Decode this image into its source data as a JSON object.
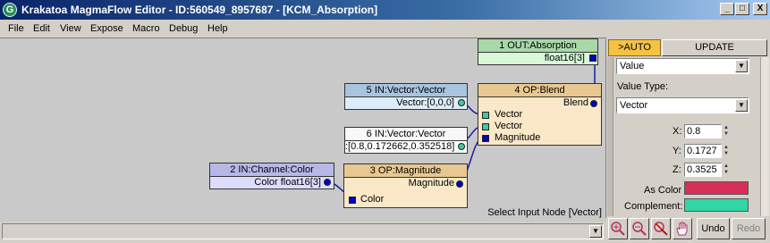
{
  "window": {
    "title": "Krakatoa MagmaFlow Editor - ID:560549_8957687 - [KCM_Absorption]",
    "icon_glyph": "G",
    "minimize_glyph": "_",
    "maximize_glyph": "□",
    "close_glyph": "X"
  },
  "menu": [
    "File",
    "Edit",
    "View",
    "Expose",
    "Macro",
    "Debug",
    "Help"
  ],
  "nodes": {
    "out_absorption": {
      "title": "1 OUT:Absorption",
      "port": "float16[3]",
      "header_color": "#a8d8a8",
      "body_color": "#d8f8d8"
    },
    "in_vector": {
      "title": "5 IN:Vector:Vector",
      "port": "Vector:[0,0,0]",
      "header_color": "#a8c4e0",
      "body_color": "#dcecfa"
    },
    "op_blend": {
      "title": "4 OP:Blend",
      "output": "Blend",
      "inputs": [
        "Vector",
        "Vector",
        "Magnitude"
      ],
      "header_color": "#e8c890",
      "body_color": "#fae8c8"
    },
    "in_vector2": {
      "title": "6 IN:Vector:Vector",
      "port": ":[0.8,0.172662,0.352518]",
      "header_color": "#f8f8f8",
      "body_color": "#ffffff"
    },
    "in_channel": {
      "title": "2 IN:Channel:Color",
      "port": "Color float16[3]",
      "header_color": "#b8b8e8",
      "body_color": "#dcdcfc"
    },
    "op_magnitude": {
      "title": "3 OP:Magnitude",
      "output": "Magnitude",
      "inputs": [
        "Color"
      ],
      "header_color": "#e8c890",
      "body_color": "#fae8c8"
    }
  },
  "status_message": "Select Input Node [Vector]",
  "panel": {
    "tab_auto": ">AUTO",
    "tab_update": "UPDATE",
    "value_combo": "Value",
    "value_type_label": "Value Type:",
    "value_type_combo": "Vector",
    "x_label": "X:",
    "x_value": "0.8",
    "y_label": "Y:",
    "y_value": "0.1727",
    "z_label": "Z:",
    "z_value": "0.3525",
    "as_color_label": "As Color",
    "as_color": "#d6305a",
    "complement_label": "Complement:",
    "complement_color": "#30d6a6"
  },
  "toolbar": {
    "undo_label": "Undo",
    "redo_label": "Redo",
    "zoom_in_icon": "zoom-in-icon",
    "zoom_out_icon": "zoom-out-icon",
    "zoom_reset_icon": "zoom-reset-icon",
    "pan_icon": "pan-hand-icon"
  },
  "colors": {
    "wire": "#1a1aa0",
    "socket_square": "#0000c0",
    "socket_green": "#40c8a0",
    "auto_tab": "#f5c242"
  }
}
